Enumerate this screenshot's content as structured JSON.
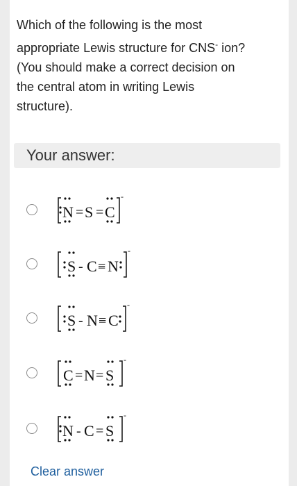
{
  "question": {
    "line1": "Which of the following is the most",
    "line2_prefix": "appropriate Lewis structure for CNS",
    "line2_sup": "-",
    "line2_suffix": " ion?",
    "line3": "(You should make a correct decision on",
    "line4": "the central atom in writing Lewis",
    "line5": "structure)."
  },
  "answer_label": "Your answer:",
  "options": [
    {
      "atoms": [
        "N",
        "S",
        "C"
      ],
      "bonds": [
        "=",
        "="
      ],
      "charge": "-"
    },
    {
      "atoms": [
        "S",
        "C",
        "N"
      ],
      "bonds": [
        "-",
        "≡"
      ],
      "charge": "-"
    },
    {
      "atoms": [
        "S",
        "N",
        "C"
      ],
      "bonds": [
        "-",
        "≡"
      ],
      "charge": "-"
    },
    {
      "atoms": [
        "C",
        "N",
        "S"
      ],
      "bonds": [
        "=",
        "="
      ],
      "charge": "-"
    },
    {
      "atoms": [
        "N",
        "C",
        "S"
      ],
      "bonds": [
        "-",
        "="
      ],
      "charge": "-"
    }
  ],
  "clear_label": "Clear answer"
}
